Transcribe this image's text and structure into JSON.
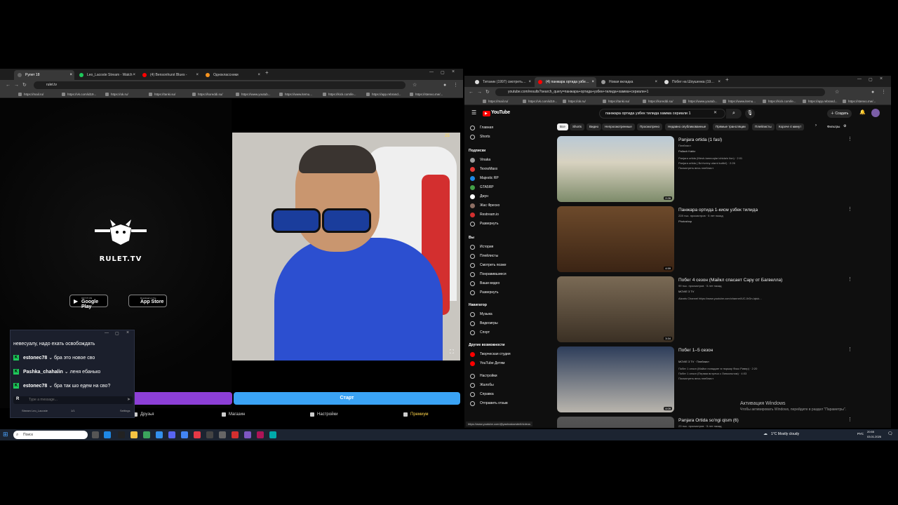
{
  "left_browser": {
    "tabs": [
      {
        "label": "Рулет 18",
        "active": true
      },
      {
        "label": "Leo_Lacoste Stream - Watch Li"
      },
      {
        "label": "(4) Bensonhurst Blues - Oscar"
      },
      {
        "label": "Одноклассники"
      }
    ],
    "address": "rulet.tv",
    "bookmarks": [
      "https://mail.ru/",
      "https://vk.com/id19...",
      "https://ok.ru/",
      "https://tanki.su/",
      "https://koreddi.su/",
      "https://www.youtub...",
      "https://www.itemu...",
      "https://kick.com/le...",
      "https://app.rebrand...",
      "https://stenvo.me/..."
    ]
  },
  "rulet": {
    "logo_text": "RULET.TV",
    "google_play": {
      "sub": "GET IT ON",
      "main": "Google Play"
    },
    "app_store": {
      "sub": "Download on the",
      "main": "App Store"
    },
    "start_button": "Старт",
    "video_counter": "25"
  },
  "chat": {
    "first_line": "невесуалу, надо ехать освобождать",
    "messages": [
      {
        "user": "estonec78",
        "text": "бра это новое сво"
      },
      {
        "user": "Pashka_chahalin",
        "text": "леня ебанько"
      },
      {
        "user": "estonec78",
        "text": "бра так шо едем на сво?"
      }
    ],
    "input_placeholder": "Type a message...",
    "footer_stream": "Stream Leo_Lacoste",
    "footer_count": "1/1",
    "footer_right": "Settings"
  },
  "rulet_bottom": [
    "Друзья",
    "Магазин",
    "Настройки",
    "Премиум"
  ],
  "right_browser": {
    "tabs": [
      {
        "label": "Титаник (1997) смотреть онл..."
      },
      {
        "label": "(4) панжара ортида узбек ти...",
        "active": true
      },
      {
        "label": "Новая вкладка"
      },
      {
        "label": "Побег на Шоушенка (1994) cм..."
      }
    ],
    "address": "youtube.com/results?search_query=панжара+ортида+узбек+тилида+хамма+сериали+1",
    "bookmarks": [
      "https://mail.ru/",
      "https://vk.com/id19...",
      "https://ok.ru/",
      "https://tanki.su/",
      "https://koreddi.su/",
      "https://www.youtub...",
      "https://www.itemu...",
      "https://kick.com/le...",
      "https://app.rebrand...",
      "https://stenvo.me/..."
    ]
  },
  "youtube": {
    "search_value": "панжара ортида узбек тилида хамма сериали 1",
    "create_label": "Создать",
    "sidebar_main": [
      "Главная",
      "Shorts"
    ],
    "subs_header": "Подписки",
    "subs": [
      "Vinaka",
      "TexnoMaxx",
      "Majestic RP",
      "GTA5RP",
      "Джун",
      "Жас Фреско",
      "Restream.io",
      "Развернуть"
    ],
    "you_header": "Вы",
    "you_items": [
      "История",
      "Плейлисты",
      "Смотреть позже",
      "Понравившиеся",
      "Ваши видео",
      "Развернуть"
    ],
    "nav_header": "Навигатор",
    "nav_items": [
      "Музыка",
      "Видеоигры",
      "Спорт"
    ],
    "other_header": "Другие возможности",
    "other_items": [
      "Творческая студия",
      "YouTube Детям"
    ],
    "settings_items": [
      "Настройки",
      "Жалобы",
      "Справка",
      "Отправить отзыв"
    ],
    "chips": [
      "Все",
      "Shorts",
      "Видео",
      "Непросмотренные",
      "Просмотрено",
      "Недавно опубликованные",
      "Прямые трансляции",
      "Плейлисты",
      "Короче 4 минут"
    ],
    "filters_label": "Фильтры",
    "videos": [
      {
        "title": "Panjara ortida (1 fasl)",
        "channel": "Pallaxh Kabiz",
        "meta": "Плейлист",
        "desc": "Panjara ortida (Mesh-tamnoqlar ichida/n ilon) · 2:01",
        "desc2": "Panjara ortida ( Bo'rivniny ularni kutib/i) · 2:26",
        "desc3": "Посмотреть весь плейлист",
        "duration": "2:26"
      },
      {
        "title": "Панжара ортида 1-кисм узбек тилида",
        "channel": "Photoshop",
        "meta": "228 тыс. просмотров · 5 лет назад",
        "desc": "",
        "desc2": "",
        "desc3": "",
        "duration": "4:59"
      },
      {
        "title": "Побег 4 сезон (Майкл спасает Сару от Багвелла)",
        "channel": "MOVIE 3 TV",
        "meta": "99 тыс. просмотров · 5 лет назад",
        "desc": "Alzaris Channel https://www.youtube.com/channel/UC-0rDn-lqtuk...",
        "desc2": "",
        "desc3": "",
        "duration": "3:34"
      },
      {
        "title": "Побег 1–5 сезон",
        "channel": "MOVIE 3 TV · Плейлист",
        "meta": "",
        "desc": "Побег 1 сезон (Майкл попадает в тюрьму Фокс Ривер) · 2:20",
        "desc2": "Побег 1 сезон (Первая встреча с Линкольном) · 4:03",
        "desc3": "Посмотреть весь плейлист",
        "duration": "4:09"
      },
      {
        "title": "Panjara Ortida so'ngi qism (6)",
        "channel": "",
        "meta": "23 тыс. просмотров · 5 лет назад",
        "desc": "",
        "desc2": "",
        "desc3": "",
        "duration": ""
      }
    ],
    "status_url": "https://www.youtube.com/@yashoskarsterli/videos"
  },
  "windows": {
    "activation_title": "Активация Windows",
    "activation_sub": "Чтобы активировать Windows, перейдите в раздел \"Параметры\".",
    "search_placeholder": "Поиск",
    "weather": "1°C Mostly cloudy",
    "lang": "РУС",
    "time": "20:55",
    "date": "03.01.2026"
  },
  "colors": {
    "yt_red": "#ff0000",
    "kick_green": "#1ec95b",
    "start_blue": "#3aa3f5",
    "purple": "#8c3fd6"
  }
}
